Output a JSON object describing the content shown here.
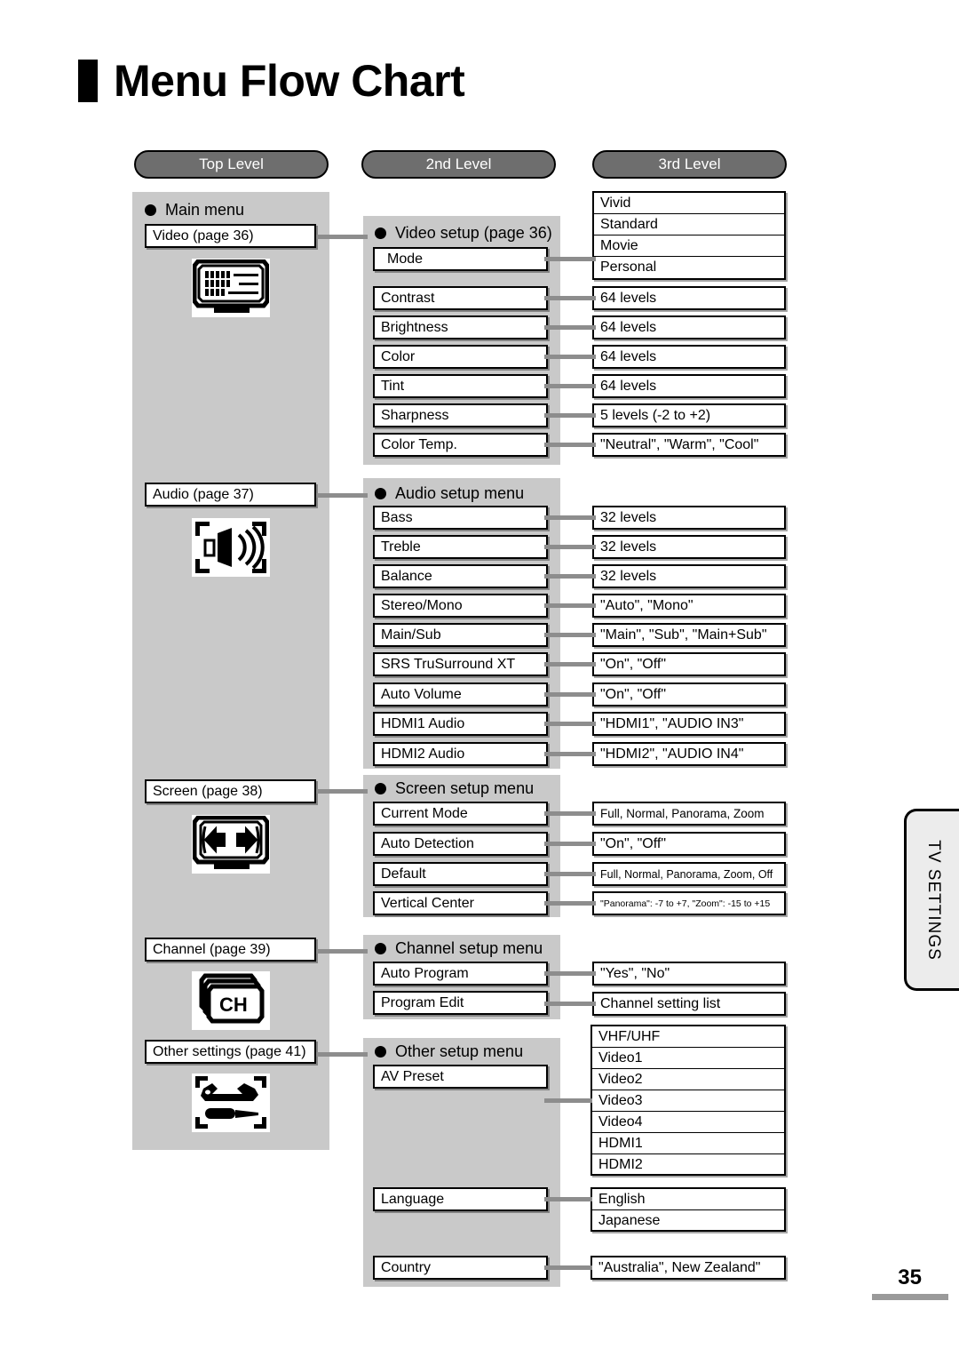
{
  "document": {
    "title": "Menu Flow Chart",
    "page_number": "35",
    "side_tab": "TV SETTINGS"
  },
  "columns": [
    {
      "label": "Top Level"
    },
    {
      "label": "2nd Level"
    },
    {
      "label": "3rd Level"
    }
  ],
  "top_level": {
    "heading": "Main menu",
    "items": [
      {
        "label": "Video (page 36)",
        "icon": "tv-video-icon"
      },
      {
        "label": "Audio (page 37)",
        "icon": "speaker-audio-icon"
      },
      {
        "label": "Screen (page 38)",
        "icon": "screen-arrows-icon"
      },
      {
        "label": "Channel (page 39)",
        "icon": "channel-ch-icon"
      },
      {
        "label": "Other settings (page 41)",
        "icon": "wrench-screwdriver-icon"
      }
    ]
  },
  "groups": {
    "video": {
      "heading": "Video setup (page 36)",
      "rows": [
        {
          "label": "Mode"
        },
        {
          "label": "Contrast"
        },
        {
          "label": "Brightness"
        },
        {
          "label": "Color"
        },
        {
          "label": "Tint"
        },
        {
          "label": "Sharpness"
        },
        {
          "label": "Color Temp."
        }
      ],
      "third": {
        "mode_options": [
          "Vivid",
          "Standard",
          "Movie",
          "Personal"
        ],
        "contrast": "64 levels",
        "brightness": "64 levels",
        "color": "64 levels",
        "tint": "64 levels",
        "sharpness": "5 levels (-2 to +2)",
        "color_temp": "\"Neutral\", \"Warm\", \"Cool\""
      }
    },
    "audio": {
      "heading": "Audio setup menu",
      "rows": [
        {
          "label": "Bass"
        },
        {
          "label": "Treble"
        },
        {
          "label": "Balance"
        },
        {
          "label": "Stereo/Mono"
        },
        {
          "label": "Main/Sub"
        },
        {
          "label": "SRS TruSurround XT"
        },
        {
          "label": "Auto Volume"
        },
        {
          "label": "HDMI1 Audio"
        },
        {
          "label": "HDMI2 Audio"
        }
      ],
      "third": [
        "32 levels",
        "32 levels",
        "32 levels",
        "\"Auto\", \"Mono\"",
        "\"Main\", \"Sub\", \"Main+Sub\"",
        "\"On\", \"Off\"",
        "\"On\", \"Off\"",
        "\"HDMI1\", \"AUDIO IN3\"",
        "\"HDMI2\", \"AUDIO IN4\""
      ]
    },
    "screen": {
      "heading": "Screen setup menu",
      "rows": [
        {
          "label": "Current Mode"
        },
        {
          "label": "Auto Detection"
        },
        {
          "label": "Default"
        },
        {
          "label": "Vertical Center"
        }
      ],
      "third": [
        "Full, Normal, Panorama, Zoom",
        "\"On\", \"Off\"",
        "Full, Normal, Panorama, Zoom, Off",
        "\"Panorama\": -7 to +7, \"Zoom\": -15 to +15"
      ]
    },
    "channel": {
      "heading": "Channel setup menu",
      "rows": [
        {
          "label": "Auto Program"
        },
        {
          "label": "Program Edit"
        }
      ],
      "third": [
        "\"Yes\", \"No\"",
        "Channel setting list"
      ]
    },
    "other": {
      "heading": "Other setup menu",
      "rows": [
        {
          "label": "AV Preset"
        },
        {
          "label": "Language"
        },
        {
          "label": "Country"
        }
      ],
      "third": {
        "av_preset": [
          "VHF/UHF",
          "Video1",
          "Video2",
          "Video3",
          "Video4",
          "HDMI1",
          "HDMI2"
        ],
        "language": [
          "English",
          "Japanese"
        ],
        "country": "\"Australia\", New Zealand\""
      }
    }
  }
}
